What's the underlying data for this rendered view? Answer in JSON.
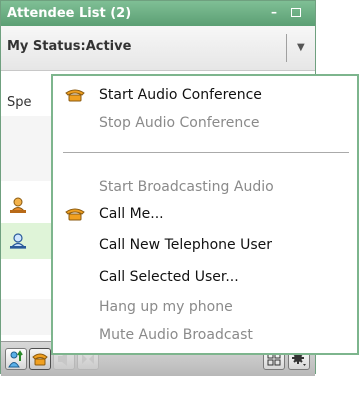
{
  "window": {
    "title": "Attendee List (2)",
    "minimize_glyph": "–"
  },
  "status": {
    "label": "My Status:Active",
    "dropdown_glyph": "▼"
  },
  "list": {
    "sp_label": "Spe"
  },
  "menu": {
    "items": [
      {
        "label": "Start Audio Conference",
        "enabled": true,
        "icon": "phone-icon"
      },
      {
        "label": "Stop Audio Conference",
        "enabled": false,
        "icon": ""
      },
      {
        "label": "Start Broadcasting Audio",
        "enabled": false,
        "icon": ""
      },
      {
        "label": "Call Me...",
        "enabled": true,
        "icon": "phone-icon"
      },
      {
        "label": "Call New Telephone User",
        "enabled": true,
        "icon": ""
      },
      {
        "label": "Call Selected User...",
        "enabled": true,
        "icon": ""
      },
      {
        "label": "Hang up my phone",
        "enabled": false,
        "icon": ""
      },
      {
        "label": "Mute Audio Broadcast",
        "enabled": false,
        "icon": ""
      }
    ]
  },
  "users": [
    {
      "icon": "presenter-user-icon"
    },
    {
      "icon": "user-icon"
    }
  ],
  "toolbar": {
    "buttons": [
      {
        "icon": "raise-hand-icon",
        "enabled": true
      },
      {
        "icon": "phone-icon",
        "enabled": true
      },
      {
        "icon": "speaker-icon",
        "enabled": false
      },
      {
        "icon": "audio-broadcast-icon",
        "enabled": false
      },
      {
        "icon": "layout-icon",
        "enabled": true
      },
      {
        "icon": "settings-gear-icon",
        "enabled": true
      }
    ]
  },
  "colors": {
    "accent": "#5c9f74",
    "selected_row": "#dff4d8",
    "phone_orange": "#f0a020"
  }
}
